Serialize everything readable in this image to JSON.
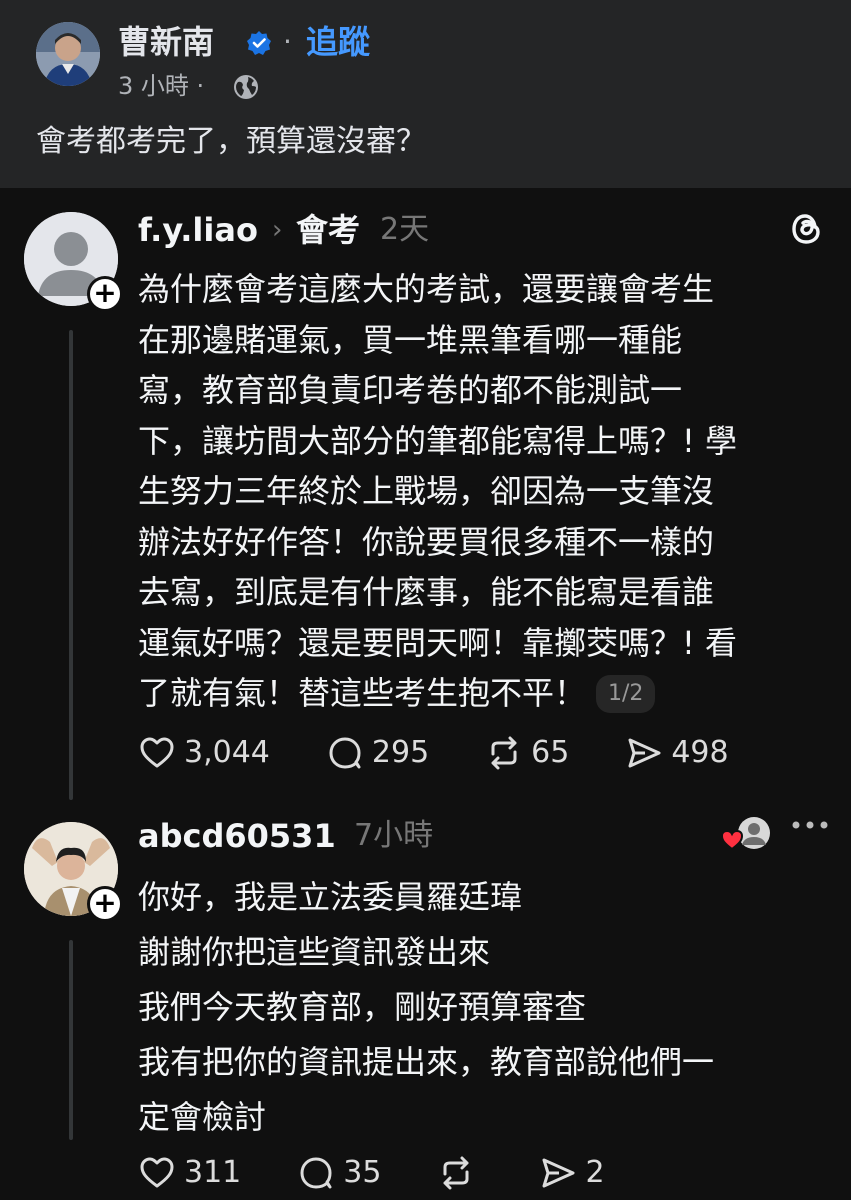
{
  "fb_post": {
    "author": "曹新南",
    "separator": "·",
    "follow_label": "追蹤",
    "time": "3 小時 ·",
    "text": "會考都考完了，預算還沒審？"
  },
  "thread_post": {
    "username": "f.y.liao",
    "chevron": "›",
    "topic": "會考",
    "time": "2天",
    "body": "為什麼會考這麼大的考試，還要讓會考生\n在那邊賭運氣，買一堆黑筆看哪一種能\n寫，教育部負責印考卷的都不能測試一\n下，讓坊間大部分的筆都能寫得上嗎？! 學\n生努力三年終於上戰場，卻因為一支筆沒\n辦法好好作答！你說要買很多種不一樣的\n去寫，到底是有什麼事，能不能寫是看誰\n運氣好嗎？還是要問天啊！靠擲茭嗎？! 看\n了就有氣！替這些考生抱不平！",
    "page_indicator": "1/2",
    "likes": "3,044",
    "comments": "295",
    "reposts": "65",
    "shares": "498"
  },
  "reply_post": {
    "username": "abcd60531",
    "time": "7小時",
    "body": "你好，我是立法委員羅廷瑋\n謝謝你把這些資訊發出來\n我們今天教育部，剛好預算審查\n我有把你的資訊提出來，教育部說他們一\n定會檢討",
    "likes": "311",
    "comments": "35",
    "reposts": "",
    "shares": "2"
  },
  "icons": {
    "verified": "verified-badge-icon",
    "globe": "globe-icon",
    "threads": "threads-logo-icon",
    "like": "heart-icon",
    "comment": "comment-bubble-icon",
    "repost": "repost-icon",
    "share": "send-icon",
    "more": "more-dots-icon"
  },
  "colors": {
    "fb_background": "#242526",
    "threads_background": "#101010",
    "follow_blue": "#4599ff",
    "verified_blue": "#1b74e4",
    "heart_red": "#ff3040"
  }
}
